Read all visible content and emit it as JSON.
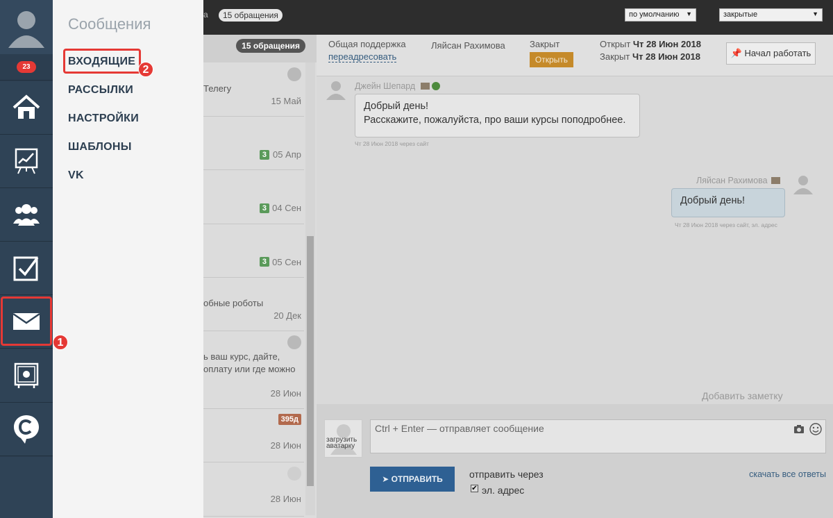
{
  "rail": {
    "badge": "23",
    "items": [
      {
        "id": "home",
        "icon": "home-icon"
      },
      {
        "id": "analytics",
        "icon": "chart-board-icon"
      },
      {
        "id": "users",
        "icon": "users-group-icon"
      },
      {
        "id": "tasks",
        "icon": "checkbox-icon"
      },
      {
        "id": "messages",
        "icon": "envelope-icon"
      },
      {
        "id": "safe",
        "icon": "safe-icon"
      },
      {
        "id": "brand",
        "icon": "brand-c-icon"
      }
    ]
  },
  "annotations": {
    "one": "1",
    "two": "2"
  },
  "menu": {
    "title": "Сообщения",
    "items": [
      "ВХОДЯЩИЕ",
      "РАССЫЛКИ",
      "НАСТРОЙКИ",
      "ШАБЛОНЫ",
      "VK"
    ]
  },
  "topbar": {
    "fragment": "а",
    "requests_pill": "15 обращения",
    "sort_select": "по умолчанию",
    "filter_select": "закрытые"
  },
  "list": {
    "count": "15 обращения",
    "rows": [
      {
        "text": "Телегу",
        "date": "15 Май"
      },
      {
        "text": "",
        "date": "05 Апр",
        "badge": "3"
      },
      {
        "text": "",
        "date": "04 Сен",
        "badge": "3"
      },
      {
        "text": "",
        "date": "05 Сен",
        "badge": "3"
      },
      {
        "text": "обные роботы",
        "date": "20 Дек"
      },
      {
        "text1": "ь ваш курс, дайте,",
        "text2": "оплату или где можно",
        "date": "28 Июн"
      },
      {
        "text": "",
        "date": "28 Июн",
        "badge_orange": "395д"
      },
      {
        "text": "",
        "date": "28 Июн"
      }
    ]
  },
  "conversation": {
    "department": "Общая поддержка",
    "redirect_link": "переадресовать",
    "agent": "Ляйсан Рахимова",
    "status": "Закрыт",
    "open_button": "Открыть",
    "opened_label": "Открыт",
    "opened_date": "Чт 28 Июн 2018",
    "closed_label": "Закрыт",
    "closed_date": "Чт 28 Июн 2018",
    "start_work_button": "Начал работать",
    "messages": [
      {
        "author": "Джейн Шепард",
        "line1": "Добрый день!",
        "line2": "Расскажите, пожалуйста, про ваши курсы поподробнее.",
        "meta": "Чт 28 Июн 2018 через сайт"
      },
      {
        "author": "Ляйсан Рахимова",
        "line1": "Добрый день!",
        "meta": "Чт 28 Июн 2018 через сайт, эл. адрес"
      }
    ],
    "add_note": "Добавить заметку"
  },
  "composer": {
    "avatar_caption": "загрузить аватарку",
    "placeholder": "Ctrl + Enter — отправляет сообщение",
    "send_button": "ОТПРАВИТЬ",
    "send_via": "отправить через",
    "email_option": "эл. адрес",
    "download_link": "скачать все ответы"
  }
}
